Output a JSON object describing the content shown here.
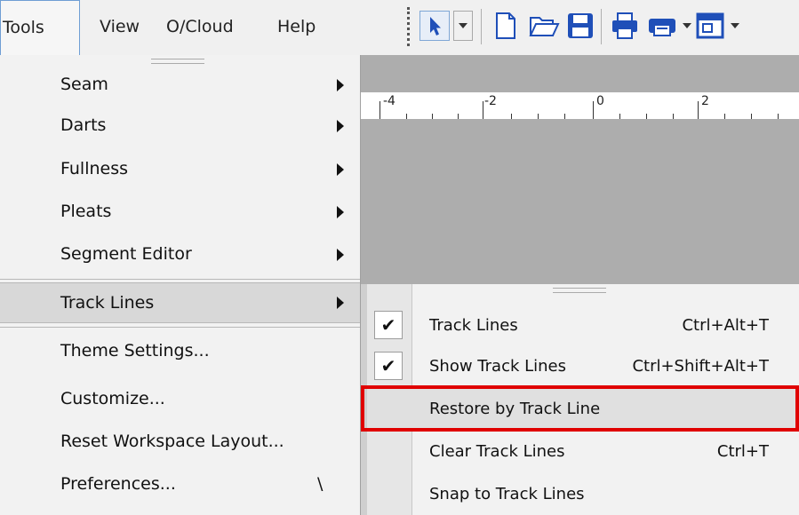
{
  "menubar": {
    "tools": "Tools",
    "view": "View",
    "cloud": "O/Cloud",
    "help": "Help"
  },
  "ruler": {
    "labels": [
      "-4",
      "-2",
      "0",
      "2"
    ]
  },
  "tools_menu": {
    "items": [
      {
        "label": "Seam",
        "submenu": true
      },
      {
        "label": "Darts",
        "submenu": true
      },
      {
        "label": "Fullness",
        "submenu": true
      },
      {
        "label": "Pleats",
        "submenu": true
      },
      {
        "label": "Segment Editor",
        "submenu": true
      },
      {
        "label": "Track Lines",
        "submenu": true,
        "highlighted": true
      },
      {
        "label": "Theme Settings..."
      },
      {
        "label": "Customize..."
      },
      {
        "label": "Reset Workspace Layout..."
      },
      {
        "label": "Preferences...",
        "shortcut": "\\"
      }
    ]
  },
  "track_lines_submenu": {
    "items": [
      {
        "label": "Track Lines",
        "shortcut": "Ctrl+Alt+T",
        "checked": true
      },
      {
        "label": "Show Track Lines",
        "shortcut": "Ctrl+Shift+Alt+T",
        "checked": true
      },
      {
        "label": "Restore by Track Line",
        "shortcut": "",
        "highlighted": true
      },
      {
        "label": "Clear Track Lines",
        "shortcut": "Ctrl+T"
      },
      {
        "label": "Snap to Track Lines",
        "shortcut": ""
      }
    ],
    "check_glyph": "✔"
  },
  "colors": {
    "highlight_outline": "#e00000",
    "toolbar_blue": "#1f4fb8"
  },
  "icons": [
    "pointer-icon",
    "new-document-icon",
    "open-folder-icon",
    "save-icon",
    "print-icon",
    "plotter-icon",
    "layout-icon"
  ]
}
